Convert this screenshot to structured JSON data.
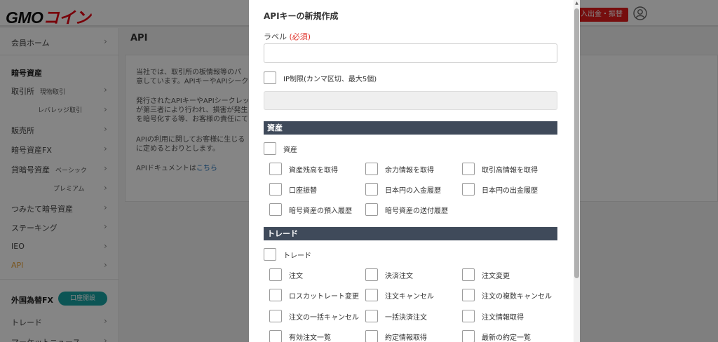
{
  "header": {
    "logo_main": "GMO",
    "logo_accent": "コイン",
    "deposit_button": "入出金・振替"
  },
  "sidebar": {
    "items": [
      {
        "label": "会員ホーム"
      },
      {
        "label": "暗号資産"
      },
      {
        "label": "取引所",
        "sub": "現物取引"
      },
      {
        "label": "",
        "sub": "レバレッジ取引"
      },
      {
        "label": "販売所"
      },
      {
        "label": "暗号資産FX"
      },
      {
        "label": "貸暗号資産",
        "sub": "ベーシック"
      },
      {
        "label": "",
        "sub": "プレミアム"
      },
      {
        "label": "つみたて暗号資産"
      },
      {
        "label": "ステーキング"
      },
      {
        "label": "IEO"
      },
      {
        "label": "API"
      },
      {
        "label": "外国為替FX"
      },
      {
        "label": "トレード"
      },
      {
        "label": "マーケットニュース"
      }
    ],
    "open_account_button": "口座開設"
  },
  "main": {
    "title": "API",
    "lines": [
      "当社では、取引所の板情報等のパ",
      "意しています。APIキーやAPIシーク",
      "発行されたAPIキーやAPIシークレッ",
      "が第三者により行われ、損害が発生",
      "を暗号化する等、お客様の責任にて",
      "APIの利用に関してお客様に生じる",
      "に定めるとおりとします。",
      "APIドキュメントは"
    ],
    "doc_link": "こちら"
  },
  "modal": {
    "title": "APIキーの新規作成",
    "label_field": {
      "label": "ラベル",
      "required": "(必須)",
      "value": ""
    },
    "ip_restriction": {
      "label": "IP制限(カンマ区切、最大5個)",
      "value": ""
    },
    "sections": [
      {
        "title": "資産",
        "master": "資産",
        "permissions": [
          "資産残高を取得",
          "余力情報を取得",
          "取引高情報を取得",
          "口座振替",
          "日本円の入金履歴",
          "日本円の出金履歴",
          "暗号資産の預入履歴",
          "暗号資産の送付履歴"
        ]
      },
      {
        "title": "トレード",
        "master": "トレード",
        "permissions": [
          "注文",
          "決済注文",
          "注文変更",
          "ロスカットレート変更",
          "注文キャンセル",
          "注文の複数キャンセル",
          "注文の一括キャンセル",
          "一括決済注文",
          "注文情報取得",
          "有効注文一覧",
          "約定情報取得",
          "最新の約定一覧"
        ]
      }
    ]
  }
}
